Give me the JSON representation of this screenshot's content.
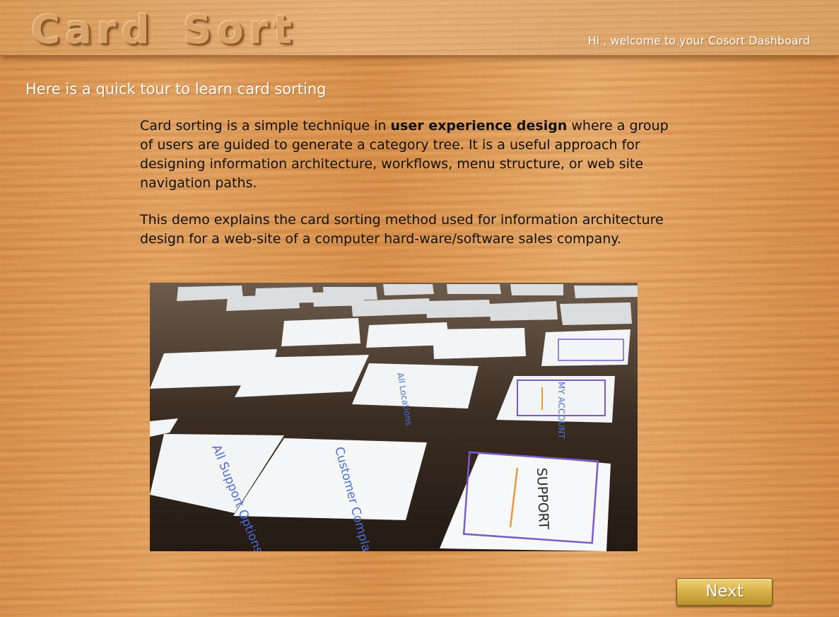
{
  "header": {
    "logo_text": "Card Sort",
    "welcome_text": "Hi , welcome to your Cosort Dashboard"
  },
  "tour": {
    "title": "Here is a quick tour to learn card sorting",
    "paragraph1_before": "Card sorting is a simple technique in ",
    "paragraph1_bold": "user experience design",
    "paragraph1_after": " where a group of users are guided to generate a category tree. It is a useful approach for designing information architecture, workflows, menu structure, or web site navigation paths.",
    "paragraph2": "This  demo  explains the  card  sorting  method used for information architecture design  for a web-site of a computer hard-ware/software sales company."
  },
  "photo": {
    "card_texts": [
      "All Support Options",
      "Customer Complaints",
      "SUPPORT",
      "All Locations",
      "MY ACCOUNT"
    ]
  },
  "navigation": {
    "next_label": "Next"
  },
  "colors": {
    "wood": "#de9a56",
    "button_gold": "#d9b24c",
    "ink_blue": "#4a6fd8",
    "ink_purple": "#7a5cc8",
    "ink_orange": "#e79a3a"
  }
}
